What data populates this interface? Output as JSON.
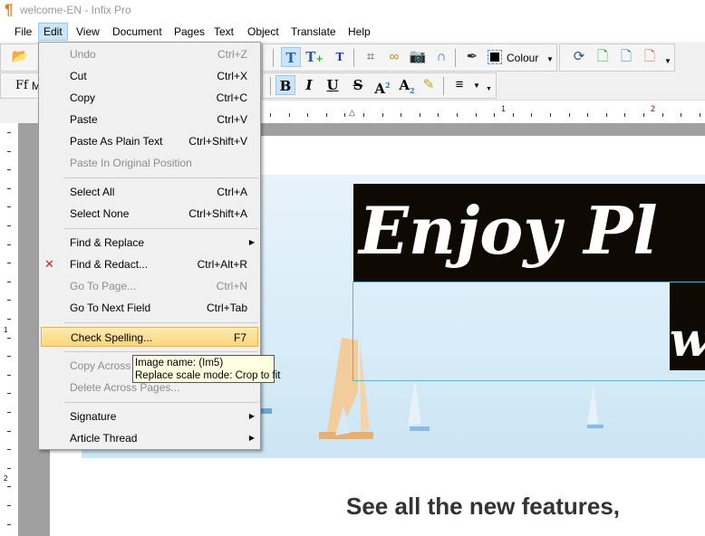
{
  "window": {
    "title": "welcome-EN - Infix Pro"
  },
  "menubar": [
    "File",
    "Edit",
    "View",
    "Document",
    "Pages",
    "Text",
    "Object",
    "Translate",
    "Help"
  ],
  "toolbar": {
    "colour_label": "Colour",
    "font_prefix": "M"
  },
  "ruler": {
    "marks": [
      "1",
      "2"
    ]
  },
  "vruler": {
    "marks": [
      "1",
      "2"
    ]
  },
  "edit_menu": [
    {
      "label": "Undo",
      "shortcut": "Ctrl+Z",
      "disabled": true
    },
    {
      "label": "Cut",
      "shortcut": "Ctrl+X"
    },
    {
      "label": "Copy",
      "shortcut": "Ctrl+C"
    },
    {
      "label": "Paste",
      "shortcut": "Ctrl+V"
    },
    {
      "label": "Paste As Plain Text",
      "shortcut": "Ctrl+Shift+V"
    },
    {
      "label": "Paste In Original Position",
      "shortcut": "",
      "disabled": true
    },
    {
      "sep": true
    },
    {
      "label": "Select All",
      "shortcut": "Ctrl+A"
    },
    {
      "label": "Select None",
      "shortcut": "Ctrl+Shift+A"
    },
    {
      "sep": true
    },
    {
      "label": "Find & Replace",
      "submenu": true
    },
    {
      "label": "Find & Redact...",
      "shortcut": "Ctrl+Alt+R",
      "icon": "redact-icon"
    },
    {
      "label": "Go To Page...",
      "shortcut": "Ctrl+N",
      "disabled": true
    },
    {
      "label": "Go To Next Field",
      "shortcut": "Ctrl+Tab"
    },
    {
      "sep": true
    },
    {
      "label": "Check Spelling...",
      "shortcut": "F7",
      "highlighted": true
    },
    {
      "sep": true
    },
    {
      "label": "Copy Across Pages...",
      "shortcut": "",
      "disabled": true
    },
    {
      "label": "Delete Across Pages...",
      "shortcut": "",
      "disabled": true
    },
    {
      "sep": true
    },
    {
      "label": "Signature",
      "submenu": true
    },
    {
      "label": "Article Thread",
      "submenu": true
    }
  ],
  "tooltip": {
    "line1": "Image name: (Im5)",
    "line2": "Replace scale mode: Crop to fit"
  },
  "document": {
    "banner_text": "Enjoy Pl",
    "banner_text2": "w",
    "heading": "See all the new features,"
  }
}
